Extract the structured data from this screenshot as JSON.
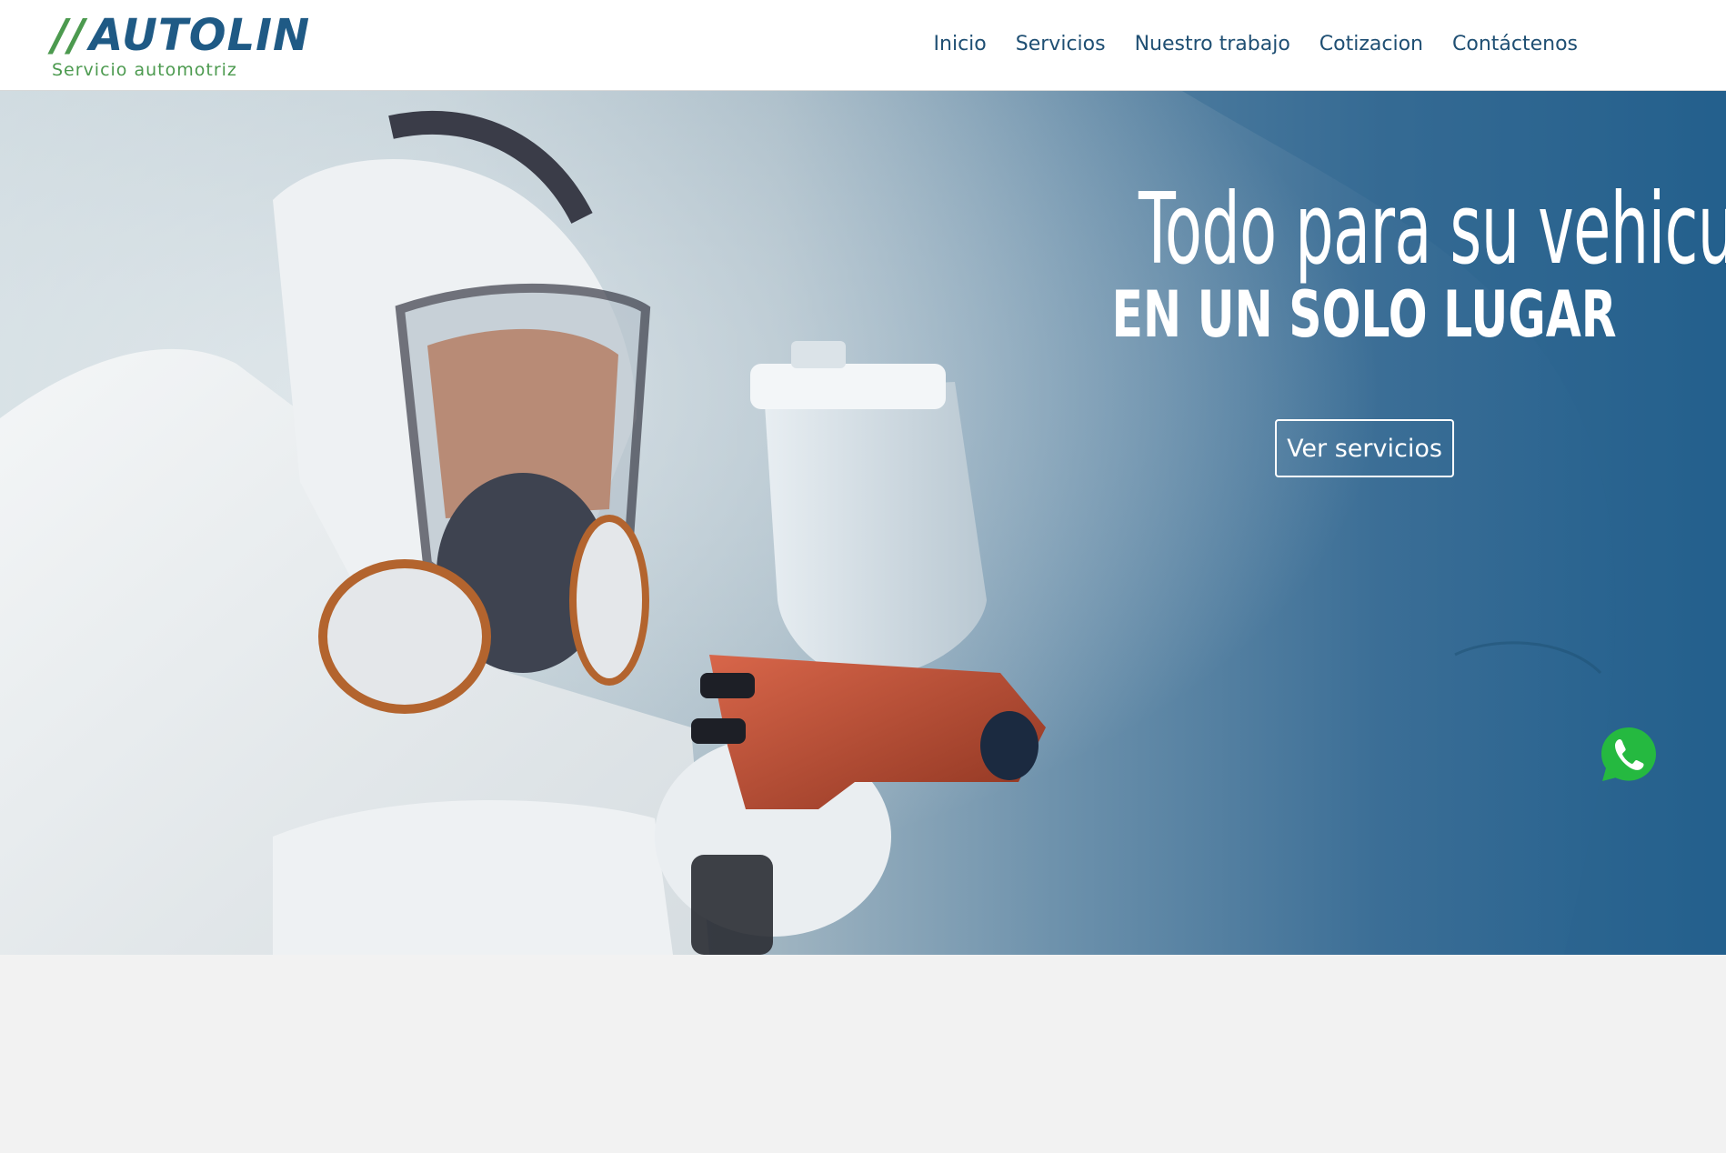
{
  "logo": {
    "slashes": "//",
    "name": "AUTOLIN",
    "tagline": "Servicio automotriz"
  },
  "nav": {
    "items": [
      {
        "label": "Inicio"
      },
      {
        "label": "Servicios"
      },
      {
        "label": "Nuestro trabajo"
      },
      {
        "label": "Cotizacion"
      },
      {
        "label": "Contáctenos"
      }
    ]
  },
  "hero": {
    "title": "Todo para su vehiculo",
    "subtitle": "EN UN SOLO LUGAR",
    "cta_label": "Ver servicios"
  },
  "colors": {
    "brand_blue": "#1f5a85",
    "brand_green": "#4c9a4f",
    "whatsapp_green": "#25b940"
  },
  "floating": {
    "icon": "whatsapp-icon"
  }
}
